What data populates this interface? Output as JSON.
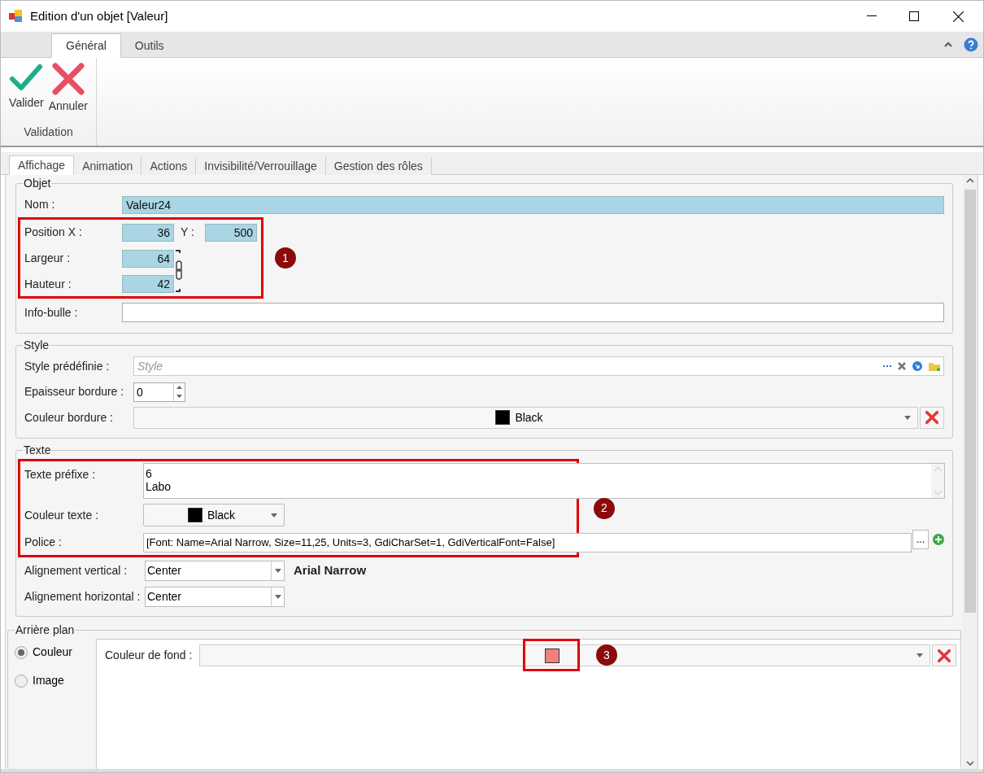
{
  "window": {
    "title": "Edition d'un objet [Valeur]"
  },
  "ribbon": {
    "tabs": [
      {
        "label": "Général",
        "selected": true
      },
      {
        "label": "Outils",
        "selected": false
      }
    ],
    "buttons": [
      {
        "label": "Valider",
        "kind": "validate"
      },
      {
        "label": "Annuler",
        "kind": "cancel"
      }
    ],
    "group_label": "Validation"
  },
  "tabs": [
    {
      "label": "Affichage",
      "selected": true
    },
    {
      "label": "Animation",
      "selected": false
    },
    {
      "label": "Actions",
      "selected": false
    },
    {
      "label": "Invisibilité/Verrouillage",
      "selected": false
    },
    {
      "label": "Gestion des rôles",
      "selected": false
    }
  ],
  "objet": {
    "title": "Objet",
    "nom": {
      "label": "Nom :",
      "value": "Valeur24"
    },
    "position_x": {
      "label": "Position X :",
      "value": "36"
    },
    "position_y": {
      "label": "Y :",
      "value": "500"
    },
    "largeur": {
      "label": "Largeur :",
      "value": "64"
    },
    "hauteur": {
      "label": "Hauteur :",
      "value": "42"
    },
    "info_bulle": {
      "label": "Info-bulle :"
    },
    "callout": "1"
  },
  "style": {
    "title": "Style",
    "style_predefinie": {
      "label": "Style prédéfinie :",
      "placeholder": "Style"
    },
    "epaisseur_bordure": {
      "label": "Epaisseur bordure :",
      "value": "0"
    },
    "couleur_bordure": {
      "label": "Couleur bordure :",
      "value": "Black",
      "color": "#000000"
    }
  },
  "texte": {
    "title": "Texte",
    "texte_prefixe": {
      "label": "Texte préfixe :",
      "lines": [
        "6",
        "Labo"
      ]
    },
    "couleur_texte": {
      "label": "Couleur texte :",
      "value": "Black",
      "color": "#000000"
    },
    "police": {
      "label": "Police :",
      "value": "[Font: Name=Arial Narrow, Size=11,25, Units=3, GdiCharSet=1, GdiVerticalFont=False]",
      "preview": "Arial Narrow",
      "browse_label": "..."
    },
    "alignement_vertical": {
      "label": "Alignement vertical :",
      "value": "Center"
    },
    "alignement_horizontal": {
      "label": "Alignement horizontal :",
      "value": "Center"
    },
    "callout": "2"
  },
  "arriere_plan": {
    "title": "Arrière plan",
    "options": [
      {
        "label": "Couleur",
        "selected": true
      },
      {
        "label": "Image",
        "selected": false
      }
    ],
    "couleur_fond": {
      "label": "Couleur de fond :",
      "color": "#f08080"
    },
    "callout": "3"
  }
}
